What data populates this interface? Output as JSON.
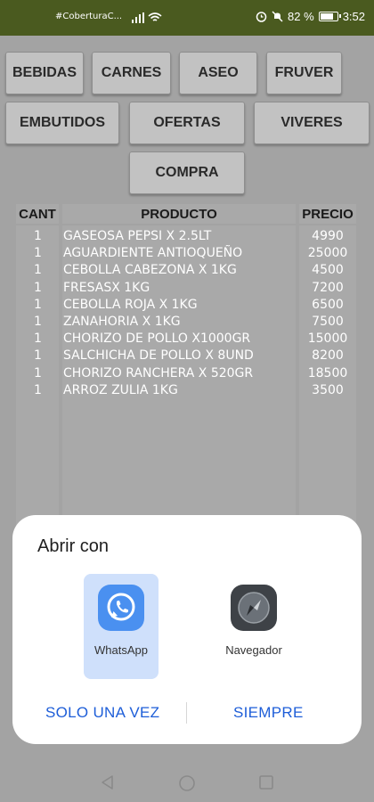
{
  "status_bar": {
    "carrier": "#CoberturaC...",
    "battery_pct": "82 %",
    "time": "3:52"
  },
  "categories": {
    "row1": [
      "BEBIDAS",
      "CARNES",
      "ASEO",
      "FRUVER"
    ],
    "row2": [
      "EMBUTIDOS",
      "OFERTAS",
      "VIVERES"
    ],
    "row3": [
      "COMPRA"
    ]
  },
  "table": {
    "headers": {
      "cant": "CANT",
      "producto": "PRODUCTO",
      "precio": "PRECIO"
    },
    "rows": [
      {
        "cant": "1",
        "producto": "GASEOSA PEPSI X 2.5LT",
        "precio": "4990"
      },
      {
        "cant": "1",
        "producto": "AGUARDIENTE ANTIOQUEÑO",
        "precio": "25000"
      },
      {
        "cant": "1",
        "producto": "CEBOLLA CABEZONA X 1KG",
        "precio": "4500"
      },
      {
        "cant": "1",
        "producto": "FRESASX 1KG",
        "precio": "7200"
      },
      {
        "cant": "1",
        "producto": "CEBOLLA ROJA X 1KG",
        "precio": "6500"
      },
      {
        "cant": "1",
        "producto": "ZANAHORIA X 1KG",
        "precio": "7500"
      },
      {
        "cant": "1",
        "producto": "CHORIZO DE POLLO X1000GR",
        "precio": "15000"
      },
      {
        "cant": "1",
        "producto": "SALCHICHA DE POLLO X 8UND",
        "precio": "8200"
      },
      {
        "cant": "1",
        "producto": "CHORIZO RANCHERA X 520GR",
        "precio": "18500"
      },
      {
        "cant": "1",
        "producto": "ARROZ ZULIA 1KG",
        "precio": "3500"
      }
    ]
  },
  "dialog": {
    "title": "Abrir con",
    "apps": [
      {
        "label": "WhatsApp",
        "icon": "whatsapp-icon",
        "selected": true
      },
      {
        "label": "Navegador",
        "icon": "browser-icon",
        "selected": false
      }
    ],
    "once_label": "SOLO UNA VEZ",
    "always_label": "SIEMPRE"
  },
  "colors": {
    "status_bar": "#4a5a1f",
    "accent": "#1e5ed8",
    "selected_tile": "#cfe0fb"
  }
}
